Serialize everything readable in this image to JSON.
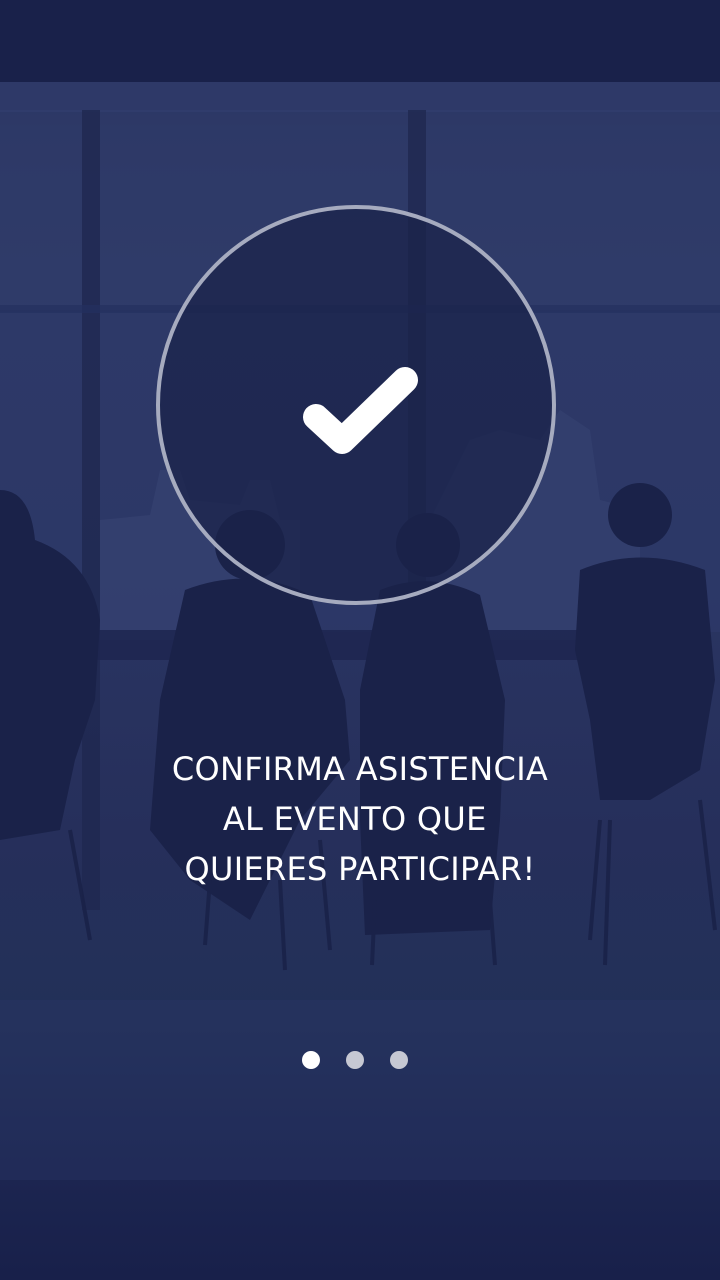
{
  "onboarding": {
    "message_lines": [
      "CONFIRMA ASISTENCIA",
      "AL EVENTO QUE ",
      "QUIERES PARTICIPAR!"
    ],
    "icon": "check-icon",
    "pagination": {
      "total": 3,
      "current": 1
    }
  },
  "colors": {
    "overlay": "#2a3562",
    "circle_border": "#a6abbf",
    "text": "#ffffff",
    "dot_active": "#ffffff",
    "dot_inactive": "#c6c8d3"
  }
}
